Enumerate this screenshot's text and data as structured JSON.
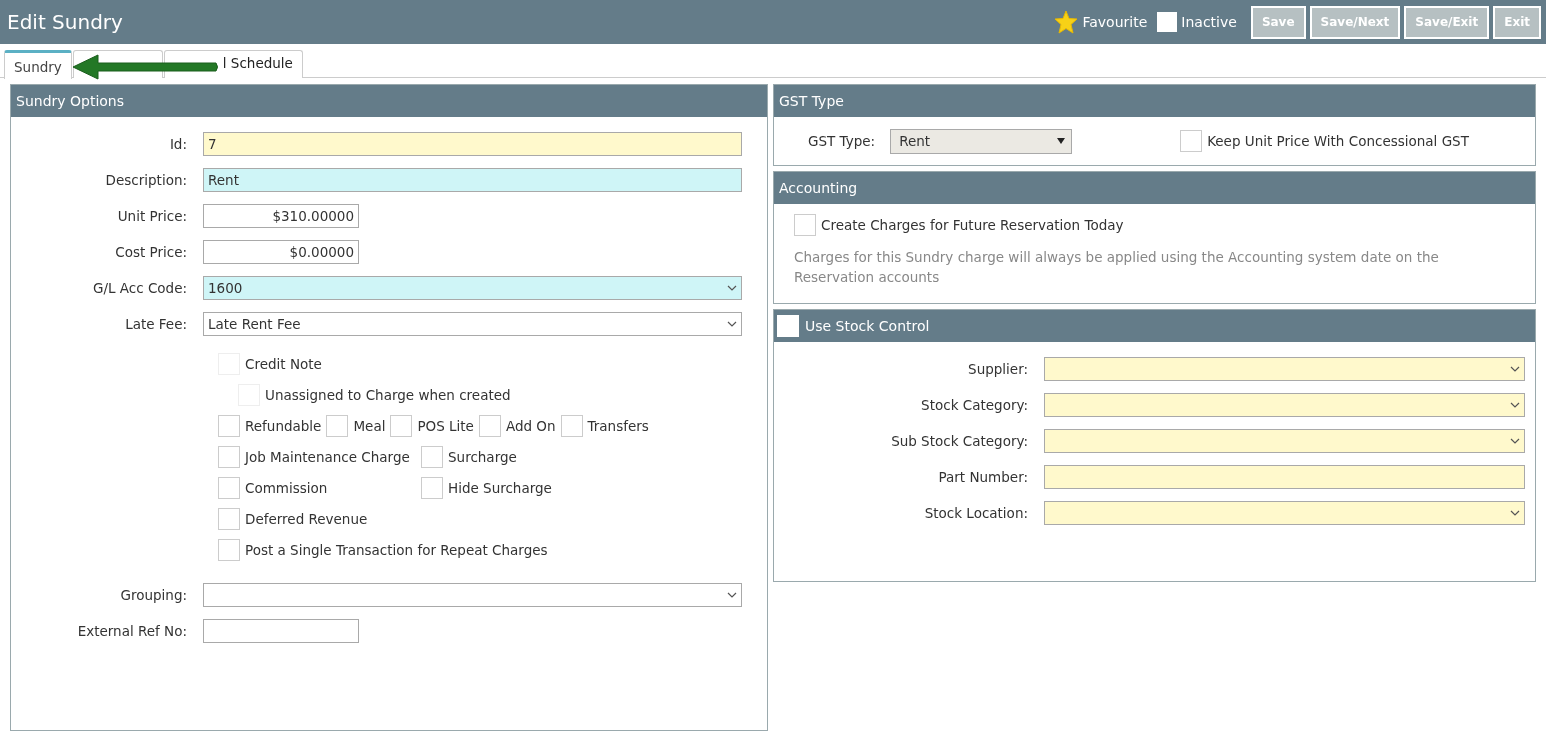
{
  "window": {
    "title": "Edit Sundry"
  },
  "header": {
    "favourite": {
      "label": "Favourite",
      "on": true
    },
    "inactive": {
      "label": "Inactive",
      "checked": false
    },
    "buttons": [
      "Save",
      "Save/Next",
      "Save/Exit",
      "Exit"
    ]
  },
  "tabs": [
    {
      "label": "Sundry",
      "selected": true
    },
    {
      "label": "l Schedule",
      "selected": false
    }
  ],
  "sundry_options": {
    "title": "Sundry Options",
    "fields": [
      {
        "label": "Id:",
        "value": "7",
        "kind": "text"
      },
      {
        "label": "Description:",
        "value": "Rent",
        "kind": "text"
      },
      {
        "label": "Unit Price:",
        "value": "$310.00000",
        "kind": "money"
      },
      {
        "label": "Cost Price:",
        "value": "$0.00000",
        "kind": "money"
      },
      {
        "label": "G/L Acc Code:",
        "value": "1600",
        "kind": "select"
      },
      {
        "label": "Late Fee:",
        "value": "Late Rent Fee",
        "kind": "select"
      }
    ],
    "checkbox_rows": [
      {
        "kind": "single",
        "items": [
          {
            "label": "Credit Note",
            "checked": false,
            "disabled": true
          }
        ]
      },
      {
        "kind": "indented",
        "items": [
          {
            "label": "Unassigned to Charge when created",
            "checked": false,
            "disabled": true
          }
        ]
      },
      {
        "kind": "inline",
        "items": [
          {
            "label": "Refundable",
            "checked": false
          },
          {
            "label": "Meal",
            "checked": false
          },
          {
            "label": "POS Lite",
            "checked": false
          },
          {
            "label": "Add On",
            "checked": false
          },
          {
            "label": "Transfers",
            "checked": false
          }
        ]
      },
      {
        "kind": "columns",
        "items": [
          {
            "label": "Job Maintenance Charge",
            "checked": false
          },
          {
            "label": "Surcharge",
            "checked": false
          }
        ]
      },
      {
        "kind": "columns",
        "items": [
          {
            "label": "Commission",
            "checked": false
          },
          {
            "label": "Hide Surcharge",
            "checked": false
          }
        ]
      },
      {
        "kind": "single",
        "items": [
          {
            "label": "Deferred Revenue",
            "checked": false
          }
        ]
      },
      {
        "kind": "single",
        "items": [
          {
            "label": "Post a Single Transaction for Repeat Charges",
            "checked": false
          }
        ]
      }
    ],
    "fields_after": [
      {
        "label": "Grouping:",
        "kind": "select"
      },
      {
        "label": "External Ref No:",
        "kind": "short"
      }
    ]
  },
  "gst_type": {
    "title": "GST Type",
    "label": "GST Type:",
    "value": "Rent",
    "keep_unit_price": {
      "label": "Keep Unit Price With Concessional GST",
      "checked": false
    }
  },
  "accounting": {
    "title": "Accounting",
    "create_charges": {
      "label": "Create Charges for Future Reservation Today",
      "checked": false
    },
    "note": "Charges for this Sundry charge will always be applied using the Accounting system date on the Reservation accounts"
  },
  "stock_control": {
    "title": "Use Stock Control",
    "checked": false,
    "fields": [
      {
        "label": "Supplier:",
        "kind": "select"
      },
      {
        "label": "Stock Category:",
        "kind": "select"
      },
      {
        "label": "Sub Stock Category:",
        "kind": "select"
      },
      {
        "label": "Part Number:",
        "kind": "text"
      },
      {
        "label": "Stock Location:",
        "kind": "select"
      }
    ]
  }
}
